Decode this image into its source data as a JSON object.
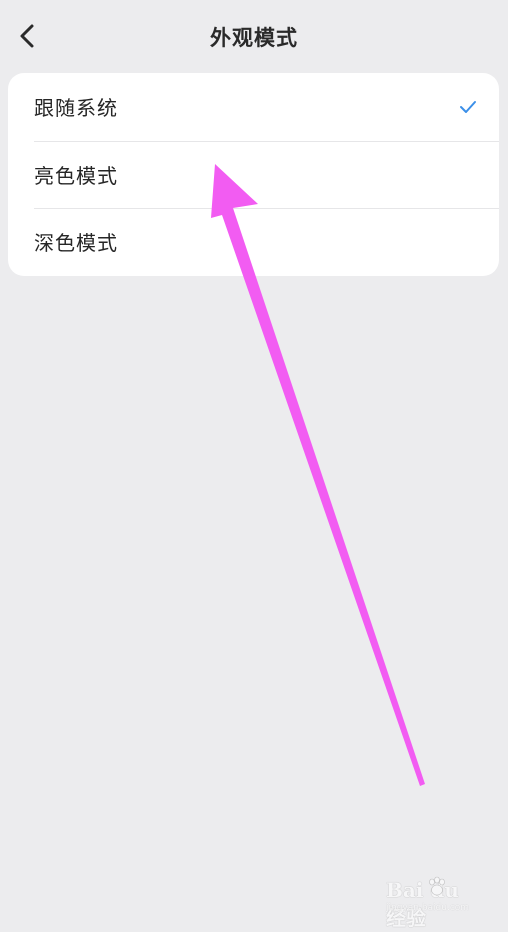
{
  "header": {
    "title": "外观模式",
    "back_icon": "chevron-left-icon"
  },
  "options": [
    {
      "label": "跟随系统",
      "selected": true
    },
    {
      "label": "亮色模式",
      "selected": false
    },
    {
      "label": "深色模式",
      "selected": false
    }
  ],
  "check_icon": "checkmark-icon",
  "colors": {
    "background": "#ececee",
    "card": "#ffffff",
    "accent_check": "#3b8fe8",
    "annotation_arrow": "#f25cf2"
  },
  "watermark": {
    "logo": "Bai du 经验",
    "sub": "jingyan.baidu.com"
  }
}
